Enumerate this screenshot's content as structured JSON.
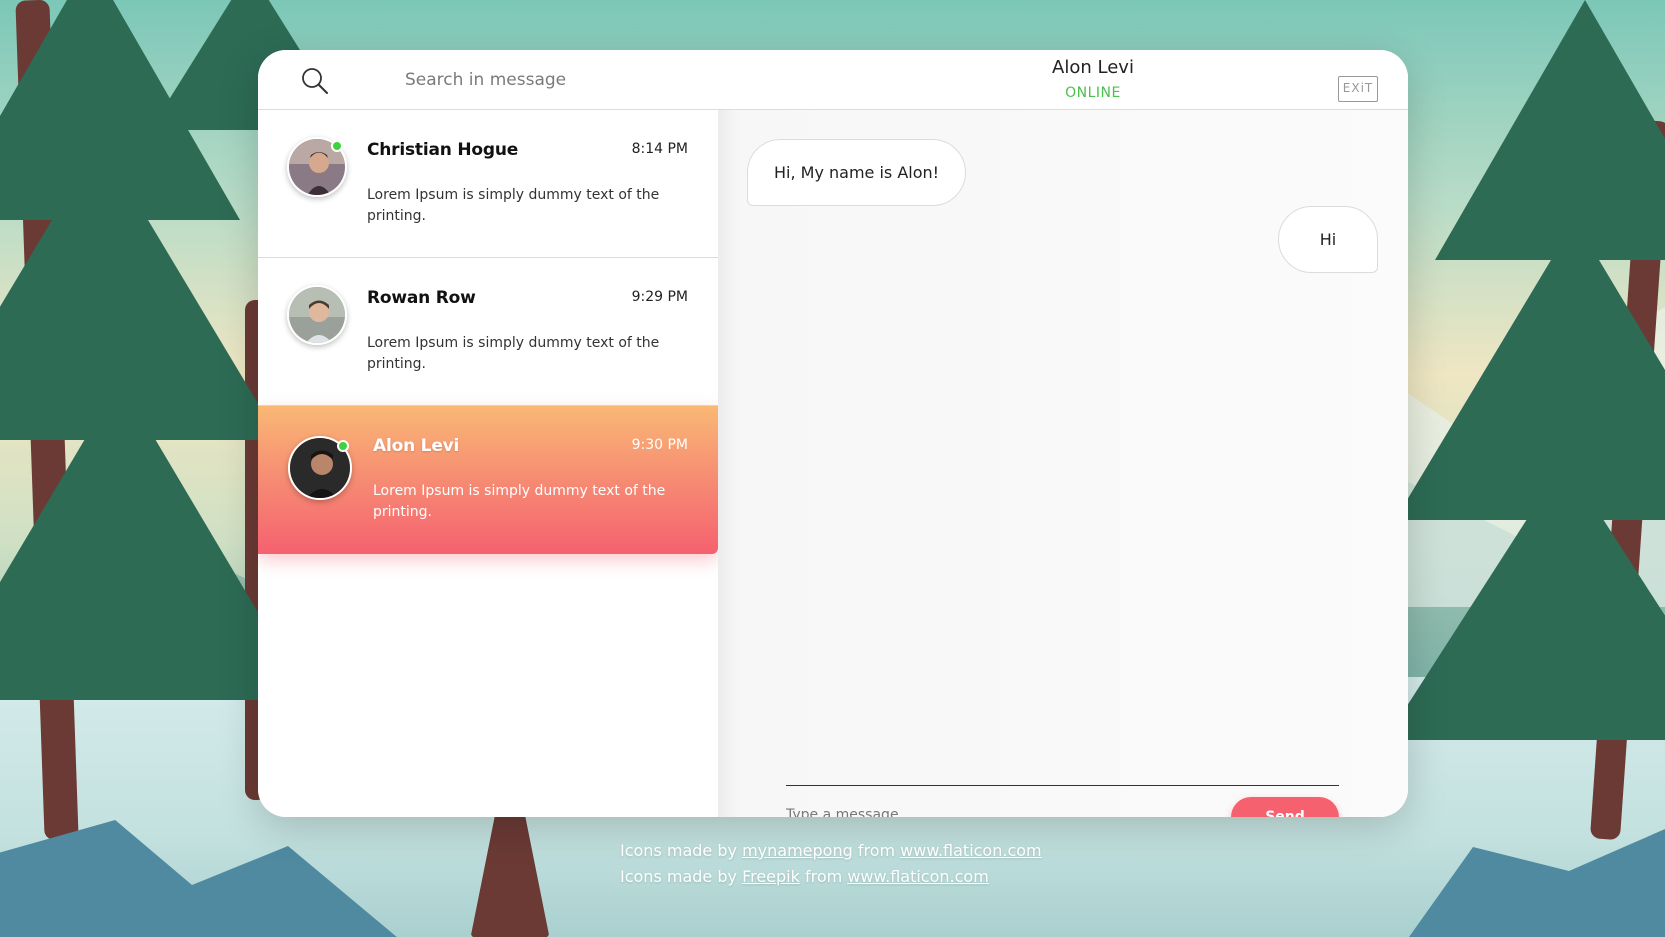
{
  "header": {
    "search_placeholder": "Search in message",
    "contact_name": "Alon Levi",
    "contact_status": "ONLINE",
    "exit_label": "EXiT"
  },
  "conversations": [
    {
      "name": "Christian Hogue",
      "time": "8:14 PM",
      "preview": "Lorem Ipsum is simply dummy text of the printing.",
      "online": true,
      "active": false
    },
    {
      "name": "Rowan Row",
      "time": "9:29 PM",
      "preview": "Lorem Ipsum is simply dummy text of the printing.",
      "online": false,
      "active": false
    },
    {
      "name": "Alon Levi",
      "time": "9:30 PM",
      "preview": "Lorem Ipsum is simply dummy text of the printing.",
      "online": true,
      "active": true
    }
  ],
  "messages": [
    {
      "direction": "incoming",
      "text": "Hi, My name is Alon!"
    },
    {
      "direction": "outgoing",
      "text": "Hi"
    }
  ],
  "composer": {
    "placeholder": "Type a message",
    "send_label": "Send"
  },
  "credits": {
    "line1_prefix": "Icons made by",
    "line1_author": "mynamepong",
    "line1_from": "from",
    "line1_site": "www.flaticon.com",
    "line2_prefix": "Icons made by",
    "line2_author": "Freepik",
    "line2_from": "from",
    "line2_site": "www.flaticon.com"
  },
  "colors": {
    "accent": "#f5616f",
    "accent_gradient_top": "#f9b874",
    "online": "#3fd13f"
  }
}
